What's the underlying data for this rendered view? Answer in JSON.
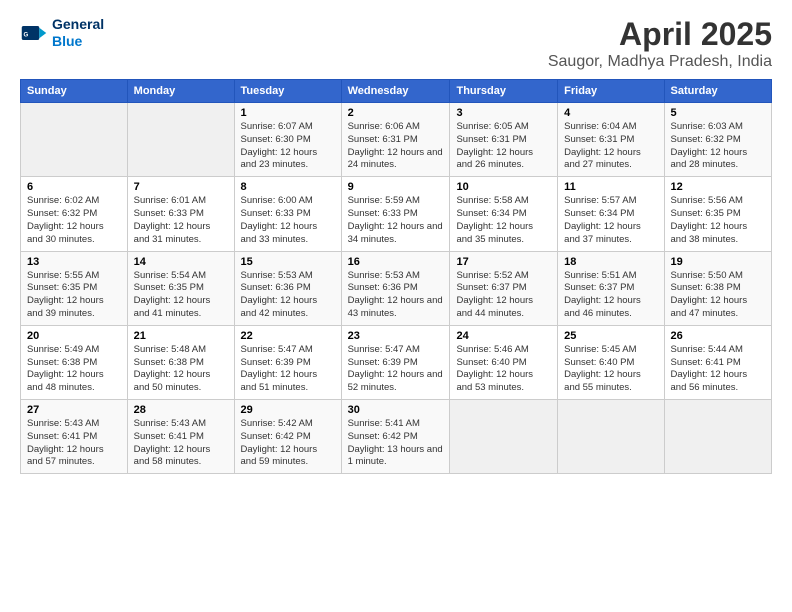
{
  "header": {
    "logo_line1": "General",
    "logo_line2": "Blue",
    "title": "April 2025",
    "subtitle": "Saugor, Madhya Pradesh, India"
  },
  "weekdays": [
    "Sunday",
    "Monday",
    "Tuesday",
    "Wednesday",
    "Thursday",
    "Friday",
    "Saturday"
  ],
  "weeks": [
    [
      {
        "day": "",
        "info": ""
      },
      {
        "day": "",
        "info": ""
      },
      {
        "day": "1",
        "info": "Sunrise: 6:07 AM\nSunset: 6:30 PM\nDaylight: 12 hours and 23 minutes."
      },
      {
        "day": "2",
        "info": "Sunrise: 6:06 AM\nSunset: 6:31 PM\nDaylight: 12 hours and 24 minutes."
      },
      {
        "day": "3",
        "info": "Sunrise: 6:05 AM\nSunset: 6:31 PM\nDaylight: 12 hours and 26 minutes."
      },
      {
        "day": "4",
        "info": "Sunrise: 6:04 AM\nSunset: 6:31 PM\nDaylight: 12 hours and 27 minutes."
      },
      {
        "day": "5",
        "info": "Sunrise: 6:03 AM\nSunset: 6:32 PM\nDaylight: 12 hours and 28 minutes."
      }
    ],
    [
      {
        "day": "6",
        "info": "Sunrise: 6:02 AM\nSunset: 6:32 PM\nDaylight: 12 hours and 30 minutes."
      },
      {
        "day": "7",
        "info": "Sunrise: 6:01 AM\nSunset: 6:33 PM\nDaylight: 12 hours and 31 minutes."
      },
      {
        "day": "8",
        "info": "Sunrise: 6:00 AM\nSunset: 6:33 PM\nDaylight: 12 hours and 33 minutes."
      },
      {
        "day": "9",
        "info": "Sunrise: 5:59 AM\nSunset: 6:33 PM\nDaylight: 12 hours and 34 minutes."
      },
      {
        "day": "10",
        "info": "Sunrise: 5:58 AM\nSunset: 6:34 PM\nDaylight: 12 hours and 35 minutes."
      },
      {
        "day": "11",
        "info": "Sunrise: 5:57 AM\nSunset: 6:34 PM\nDaylight: 12 hours and 37 minutes."
      },
      {
        "day": "12",
        "info": "Sunrise: 5:56 AM\nSunset: 6:35 PM\nDaylight: 12 hours and 38 minutes."
      }
    ],
    [
      {
        "day": "13",
        "info": "Sunrise: 5:55 AM\nSunset: 6:35 PM\nDaylight: 12 hours and 39 minutes."
      },
      {
        "day": "14",
        "info": "Sunrise: 5:54 AM\nSunset: 6:35 PM\nDaylight: 12 hours and 41 minutes."
      },
      {
        "day": "15",
        "info": "Sunrise: 5:53 AM\nSunset: 6:36 PM\nDaylight: 12 hours and 42 minutes."
      },
      {
        "day": "16",
        "info": "Sunrise: 5:53 AM\nSunset: 6:36 PM\nDaylight: 12 hours and 43 minutes."
      },
      {
        "day": "17",
        "info": "Sunrise: 5:52 AM\nSunset: 6:37 PM\nDaylight: 12 hours and 44 minutes."
      },
      {
        "day": "18",
        "info": "Sunrise: 5:51 AM\nSunset: 6:37 PM\nDaylight: 12 hours and 46 minutes."
      },
      {
        "day": "19",
        "info": "Sunrise: 5:50 AM\nSunset: 6:38 PM\nDaylight: 12 hours and 47 minutes."
      }
    ],
    [
      {
        "day": "20",
        "info": "Sunrise: 5:49 AM\nSunset: 6:38 PM\nDaylight: 12 hours and 48 minutes."
      },
      {
        "day": "21",
        "info": "Sunrise: 5:48 AM\nSunset: 6:38 PM\nDaylight: 12 hours and 50 minutes."
      },
      {
        "day": "22",
        "info": "Sunrise: 5:47 AM\nSunset: 6:39 PM\nDaylight: 12 hours and 51 minutes."
      },
      {
        "day": "23",
        "info": "Sunrise: 5:47 AM\nSunset: 6:39 PM\nDaylight: 12 hours and 52 minutes."
      },
      {
        "day": "24",
        "info": "Sunrise: 5:46 AM\nSunset: 6:40 PM\nDaylight: 12 hours and 53 minutes."
      },
      {
        "day": "25",
        "info": "Sunrise: 5:45 AM\nSunset: 6:40 PM\nDaylight: 12 hours and 55 minutes."
      },
      {
        "day": "26",
        "info": "Sunrise: 5:44 AM\nSunset: 6:41 PM\nDaylight: 12 hours and 56 minutes."
      }
    ],
    [
      {
        "day": "27",
        "info": "Sunrise: 5:43 AM\nSunset: 6:41 PM\nDaylight: 12 hours and 57 minutes."
      },
      {
        "day": "28",
        "info": "Sunrise: 5:43 AM\nSunset: 6:41 PM\nDaylight: 12 hours and 58 minutes."
      },
      {
        "day": "29",
        "info": "Sunrise: 5:42 AM\nSunset: 6:42 PM\nDaylight: 12 hours and 59 minutes."
      },
      {
        "day": "30",
        "info": "Sunrise: 5:41 AM\nSunset: 6:42 PM\nDaylight: 13 hours and 1 minute."
      },
      {
        "day": "",
        "info": ""
      },
      {
        "day": "",
        "info": ""
      },
      {
        "day": "",
        "info": ""
      }
    ]
  ]
}
